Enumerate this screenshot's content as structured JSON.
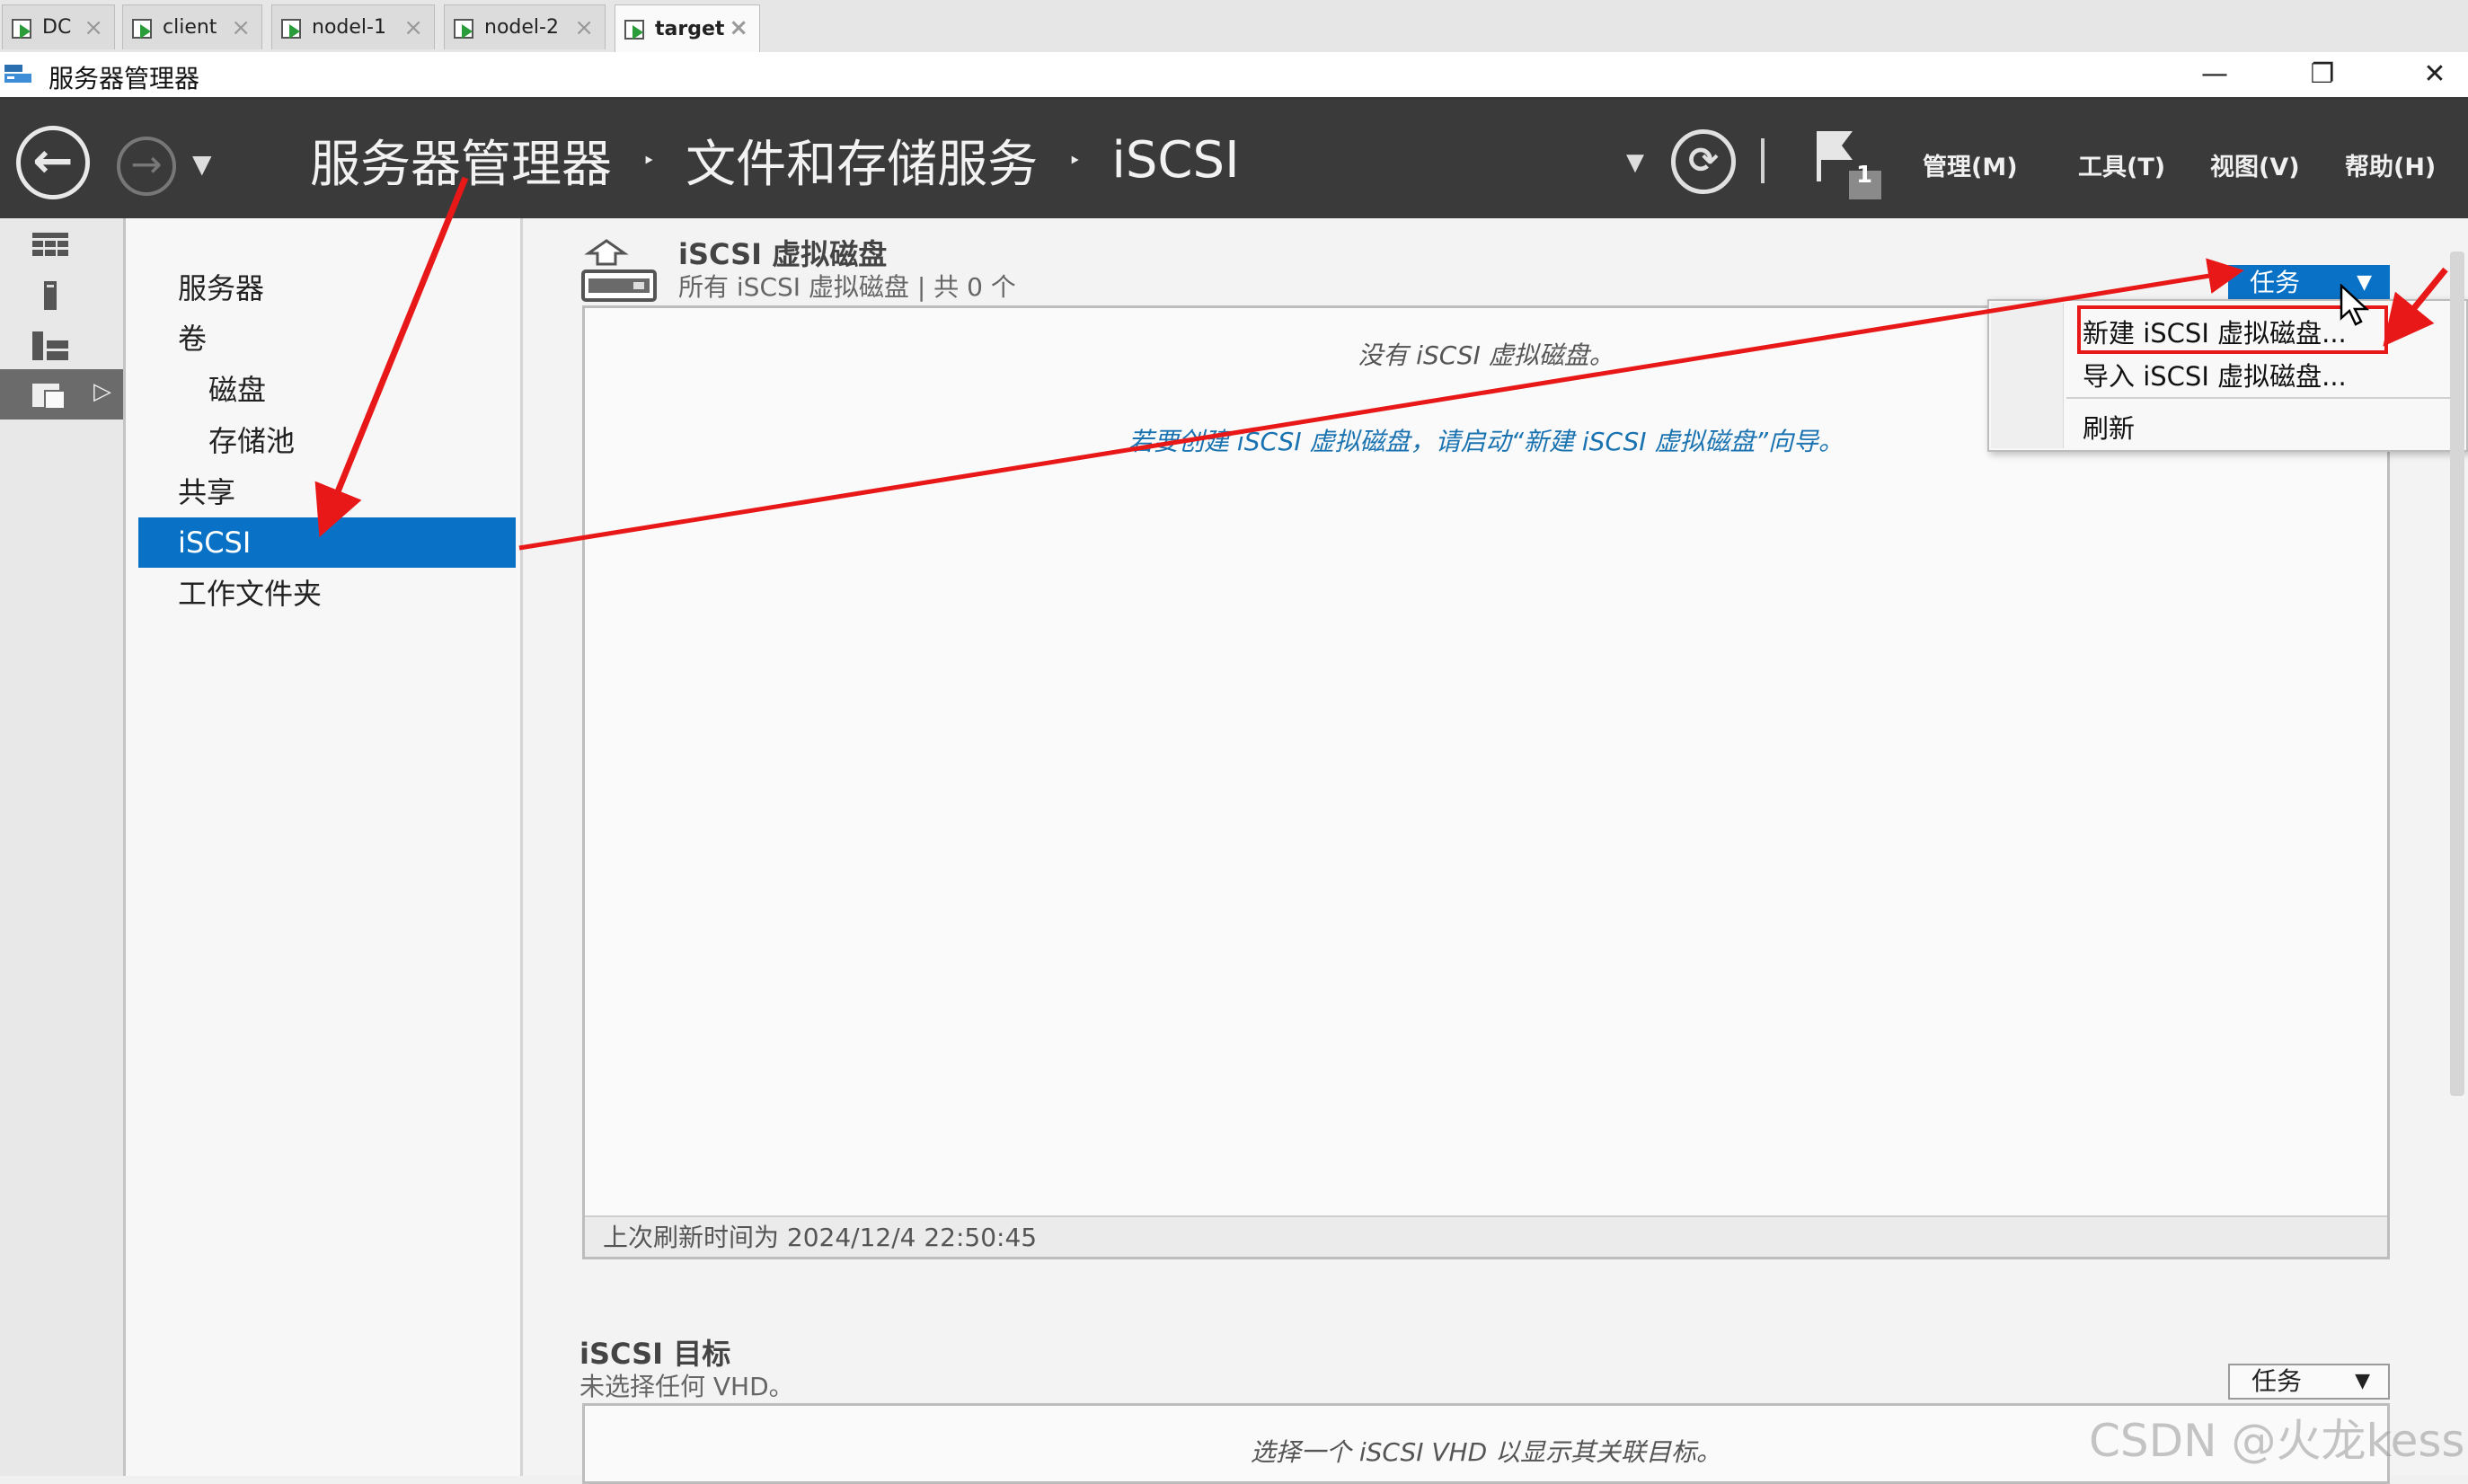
{
  "vm_tabs": [
    {
      "label": "DC",
      "active": false
    },
    {
      "label": "client",
      "active": false
    },
    {
      "label": "nodel-1",
      "active": false
    },
    {
      "label": "nodel-2",
      "active": false
    },
    {
      "label": "target",
      "active": true
    }
  ],
  "window": {
    "title": "服务器管理器",
    "minimize": "—",
    "restore": "❐",
    "close": "✕"
  },
  "header": {
    "breadcrumb": [
      "服务器管理器",
      "文件和存储服务",
      "iSCSI"
    ],
    "breadcrumb_separator": "‣",
    "notification_count": "1",
    "menus": [
      "管理(M)",
      "工具(T)",
      "视图(V)",
      "帮助(H)"
    ]
  },
  "nav": {
    "items": [
      {
        "label": "服务器",
        "indent": 0,
        "selected": false
      },
      {
        "label": "卷",
        "indent": 0,
        "selected": false
      },
      {
        "label": "磁盘",
        "indent": 1,
        "selected": false
      },
      {
        "label": "存储池",
        "indent": 1,
        "selected": false
      },
      {
        "label": "共享",
        "indent": 0,
        "selected": false
      },
      {
        "label": "iSCSI",
        "indent": 0,
        "selected": true
      },
      {
        "label": "工作文件夹",
        "indent": 0,
        "selected": false
      }
    ],
    "rail_expand": "▷"
  },
  "section_disks": {
    "title": "iSCSI 虚拟磁盘",
    "subtitle": "所有 iSCSI 虚拟磁盘 | 共 0 个",
    "tasks_label": "任务",
    "empty_message": "没有 iSCSI 虚拟磁盘。",
    "create_hint": "若要创建 iSCSI 虚拟磁盘，请启动“新建 iSCSI 虚拟磁盘”向导。",
    "last_refresh": "上次刷新时间为 2024/12/4 22:50:45"
  },
  "tasks_menu": {
    "items": [
      "新建 iSCSI 虚拟磁盘...",
      "导入 iSCSI 虚拟磁盘...",
      "刷新"
    ]
  },
  "section_targets": {
    "title": "iSCSI 目标",
    "subtitle": "未选择任何 VHD。",
    "tasks_label": "任务",
    "empty_message": "选择一个 iSCSI VHD 以显示其关联目标。"
  },
  "watermark": "CSDN @火龙kess",
  "colors": {
    "header_bg": "#3a3a3a",
    "selection_blue": "#0a72c6",
    "annotation_red": "#e81818",
    "hint_link": "#1a73b0"
  }
}
